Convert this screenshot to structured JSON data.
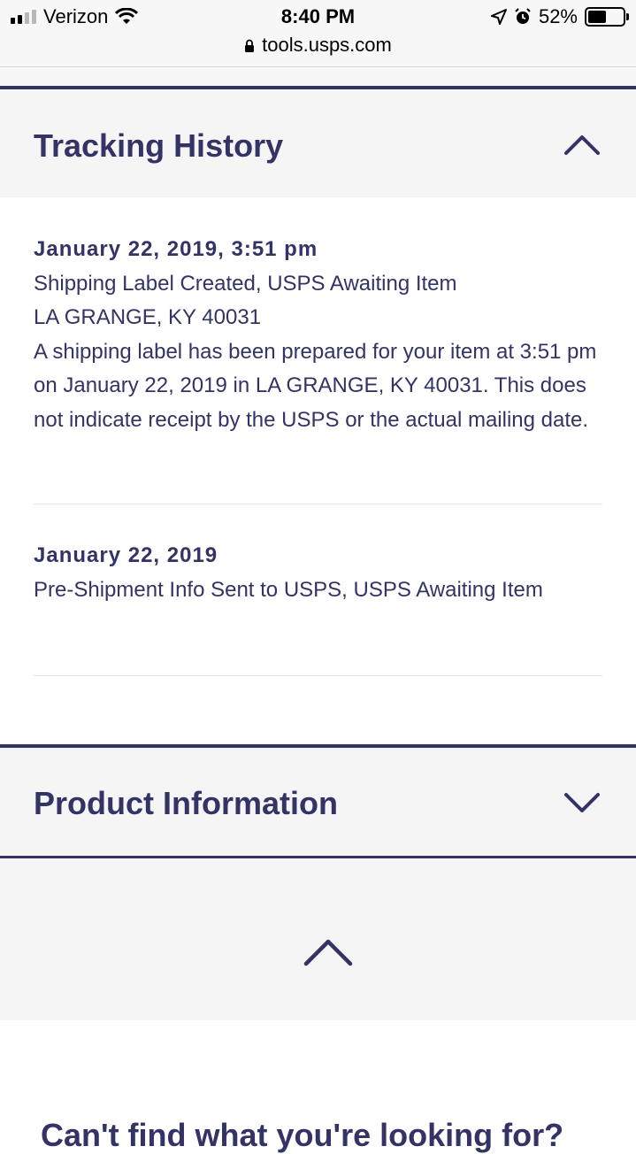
{
  "status_bar": {
    "carrier": "Verizon",
    "time": "8:40 PM",
    "battery_percent": "52%",
    "battery_level": 0.52,
    "icons": [
      "signal-bars-icon",
      "wifi-icon",
      "location-arrow-icon",
      "alarm-icon",
      "battery-icon"
    ]
  },
  "browser": {
    "url": "tools.usps.com",
    "lock_icon": "lock-icon"
  },
  "tracking_history": {
    "title": "Tracking History",
    "expanded": true,
    "toggle_icon": "chevron-up-icon",
    "events": [
      {
        "date": "January 22, 2019, 3:51 pm",
        "status": "Shipping Label Created, USPS Awaiting Item",
        "location": "LA GRANGE, KY 40031",
        "description": "A shipping label has been prepared for your item at 3:51 pm on January 22, 2019 in LA GRANGE, KY 40031. This does not indicate receipt by the USPS or the actual mailing date."
      },
      {
        "date": "January 22, 2019",
        "status": "Pre-Shipment Info Sent to USPS, USPS Awaiting Item"
      }
    ]
  },
  "product_information": {
    "title": "Product Information",
    "expanded": false,
    "toggle_icon": "chevron-down-icon"
  },
  "back_to_top": {
    "icon": "chevron-up-icon"
  },
  "faq": {
    "heading_partial": "Can't find what you're looking for?"
  },
  "colors": {
    "brand_navy": "#333366",
    "section_bg": "#f5f5f5",
    "divider": "#e3e3e3"
  }
}
